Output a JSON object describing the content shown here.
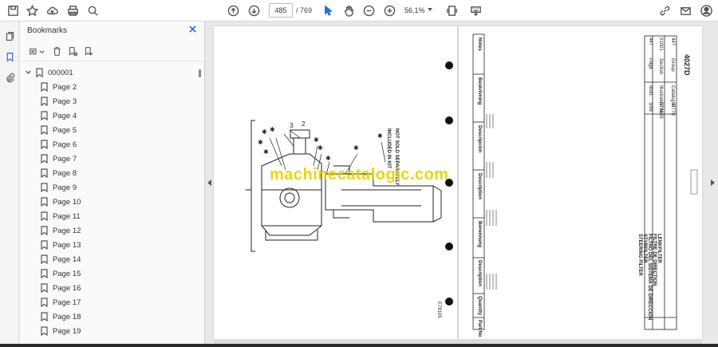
{
  "toolbar": {
    "page_current": "485",
    "page_total": "/ 769",
    "zoom": "56,1%"
  },
  "panel": {
    "title": "Bookmarks"
  },
  "bookmarks": {
    "root": "000001",
    "items": [
      "Page 2",
      "Page 3",
      "Page 4",
      "Page 5",
      "Page 6",
      "Page 7",
      "Page 8",
      "Page 9",
      "Page 10",
      "Page 11",
      "Page 12",
      "Page 13",
      "Page 14",
      "Page 15",
      "Page 16",
      "Page 17",
      "Page 18",
      "Page 19"
    ]
  },
  "document": {
    "watermark": "machinecatalogic.com",
    "model_code": "4027D",
    "parts_title_lines": [
      "LENKFILTER",
      "FILTRE DE DIRECTION",
      "FILTRO DEL SISTEMA DE DIRECCION",
      "STYRFILTER",
      "STEERING FILTER"
    ],
    "figure_number": "E78105",
    "note_not_sold": "NOT SOLD SEPARATELY",
    "note_included": "INCLUDED IN KIT",
    "col_headers": [
      "Pg",
      "Part No",
      "Quantity",
      "Description",
      "Benennung",
      "Description",
      "Descripcion",
      "Beskrivning",
      "Notes"
    ],
    "info_labels": [
      "Catalog Id",
      "Illustration No",
      "Illust.",
      "Group",
      "Section",
      "Page"
    ],
    "info_values": [
      "97770",
      "E78105",
      "3/98",
      "447",
      "01001",
      "447"
    ]
  },
  "colors": {
    "accent": "#2a6dd0",
    "watermark": "#e8d000"
  }
}
